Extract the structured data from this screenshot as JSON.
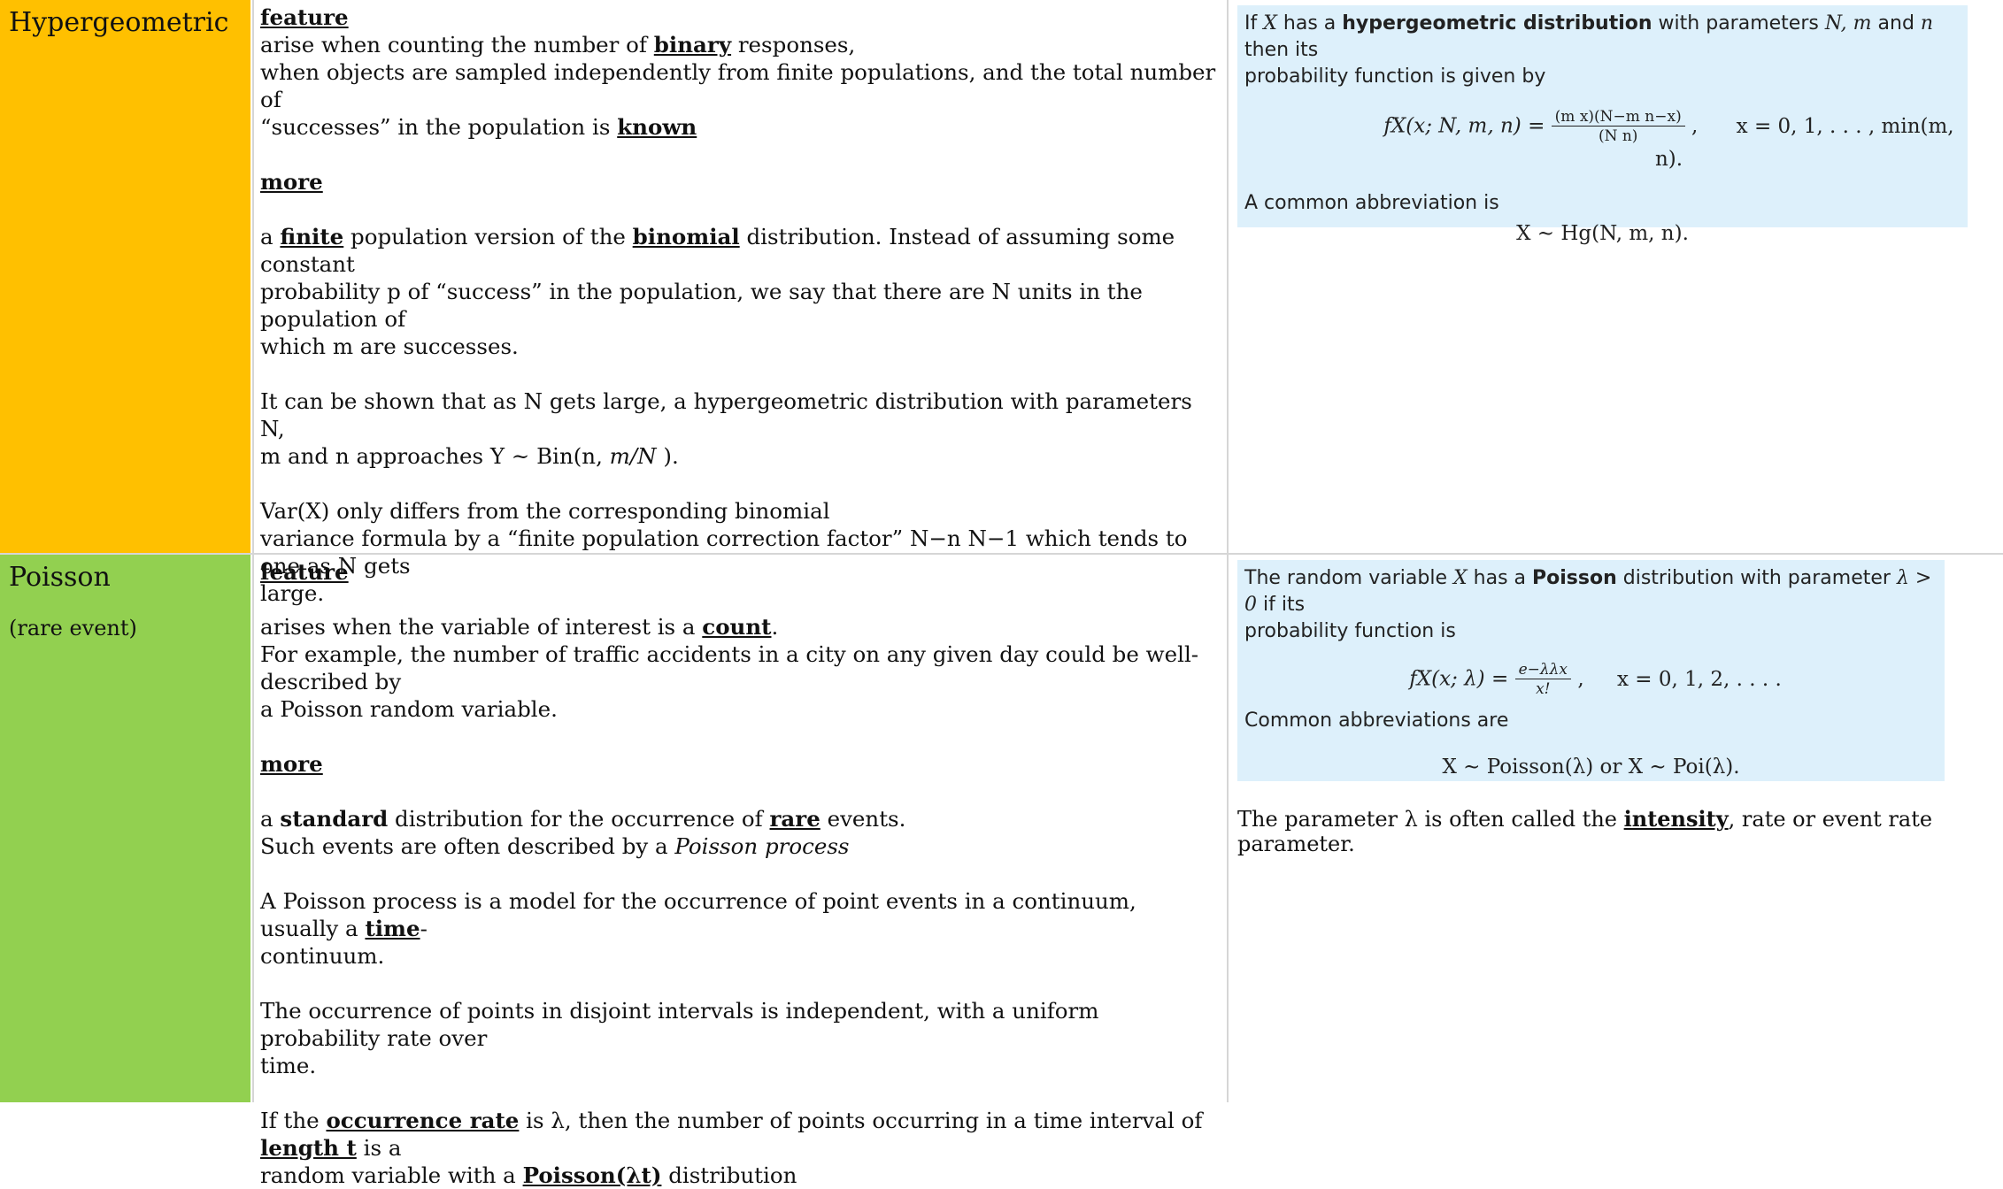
{
  "rows": [
    {
      "name": "Hypergeometric",
      "feature_heading": "feature",
      "feature_line1_a": "arise when counting the number of ",
      "feature_line1_b": "binary",
      "feature_line1_c": " responses,",
      "feature_line2": "when objects are sampled independently from finite populations, and the total number of",
      "feature_line3_a": "“successes” in the population is ",
      "feature_line3_b": "known",
      "more_heading": "more",
      "more_p1_a": "a ",
      "more_p1_b": "finite",
      "more_p1_c": " population version of the ",
      "more_p1_d": "binomial",
      "more_p1_e": " distribution. Instead of assuming some constant",
      "more_p1_line2": "probability p of “success” in the population, we say that there are N units in the population of",
      "more_p1_line3": "which m are successes.",
      "more_p2_line1": "It can be shown that as N gets large, a hypergeometric distribution with parameters N,",
      "more_p2_line2_a": "m and n approaches Y ~ Bin(n, ",
      "more_p2_line2_b": "m/N",
      "more_p2_line2_c": " ).",
      "more_p3_line1": "Var(X) only differs from the corresponding binomial",
      "more_p3_line2": "variance formula by a “finite population correction factor” N−n N−1 which tends to one as N gets",
      "more_p3_line3": "large.",
      "def_a": "If ",
      "def_X": "X",
      "def_b": " has a ",
      "def_bold": "hypergeometric distribution",
      "def_c": " with parameters ",
      "def_params": "N, m",
      "def_and": " and ",
      "def_n": "n",
      "def_d": " then its",
      "def_line2": "probability function is given by",
      "pmf_lhs": "fX(x; N, m, n) =",
      "pmf_num": "(m x)(N−m n−x)",
      "pmf_den": "(N n)",
      "pmf_support": "x = 0, 1, . . . , min(m, n).",
      "abbrev_label": "A common abbreviation is",
      "abbrev_formula": "X ∼ Hg(N, m, n)."
    },
    {
      "name": "Poisson",
      "subname": "(rare event)",
      "feature_heading": "feature",
      "feature_line1_a": "arises when the variable of interest is a ",
      "feature_line1_b": "count",
      "feature_line1_c": ".",
      "feature_line2": "For example, the number of traffic accidents in a city on any given day could be well-described by",
      "feature_line3": "a Poisson random variable.",
      "more_heading": "more",
      "more_p1_a": "a ",
      "more_p1_b": "standard",
      "more_p1_c": " distribution for the occurrence of ",
      "more_p1_d": "rare",
      "more_p1_e": " events.",
      "more_p1_line2_a": "Such events are often described by a ",
      "more_p1_line2_b": "Poisson process",
      "more_p2_a": "A Poisson process is a model for the occurrence of point events in a continuum, usually a ",
      "more_p2_b": "time",
      "more_p2_c": "-",
      "more_p2_line2": "continuum.",
      "more_p3_line1": "The occurrence of points in disjoint intervals is independent, with a uniform probability rate over",
      "more_p3_line2": "time.",
      "more_p4_a": "If the ",
      "more_p4_b": "occurrence rate",
      "more_p4_c": " is λ, then the number of points occurring in a time interval of ",
      "more_p4_d": "length t",
      "more_p4_e": " is a",
      "more_p4_line2_a": "random variable with a ",
      "more_p4_line2_b": "Poisson(λt)",
      "more_p4_line2_c": " distribution",
      "def_a": "The random variable ",
      "def_X": "X",
      "def_b": " has a ",
      "def_bold": "Poisson",
      "def_c": " distribution with parameter ",
      "def_param": "λ > 0",
      "def_d": " if its",
      "def_line2": "probability function is",
      "pmf_lhs": "fX(x; λ) =",
      "pmf_num": "e−λλx",
      "pmf_den": "x!",
      "pmf_support": "x = 0, 1, 2, . . . .",
      "abbrev_label": "Common abbreviations are",
      "abbrev_formula": "X ∼ Poisson(λ) or X ∼ Poi(λ).",
      "intensity_a": "The parameter λ is often called the ",
      "intensity_b": "intensity",
      "intensity_c": ", rate or event rate parameter."
    }
  ]
}
